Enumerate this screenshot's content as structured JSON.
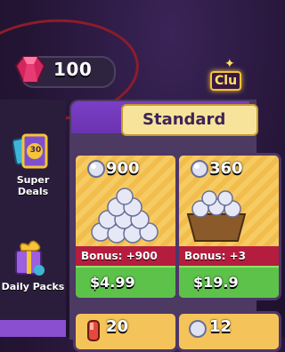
{
  "currency": {
    "gems": "100"
  },
  "club": {
    "label": "Clu"
  },
  "sidebar": {
    "items": [
      {
        "label": "Super Deals",
        "badge": "30"
      },
      {
        "label": "Daily Packs"
      }
    ]
  },
  "shop": {
    "section_title": "Standard",
    "cards": [
      {
        "amount": "900",
        "bonus": "Bonus: +900",
        "price": "$4.99"
      },
      {
        "amount": "360",
        "bonus": "Bonus: +3",
        "price": "$19.9"
      }
    ],
    "row2": [
      {
        "amount": "20"
      },
      {
        "amount": "12"
      }
    ]
  },
  "colors": {
    "accent_purple": "#6a33b0",
    "bonus_red": "#b51d3e",
    "price_green": "#5dc24a",
    "card_gold": "#f4c45a"
  }
}
